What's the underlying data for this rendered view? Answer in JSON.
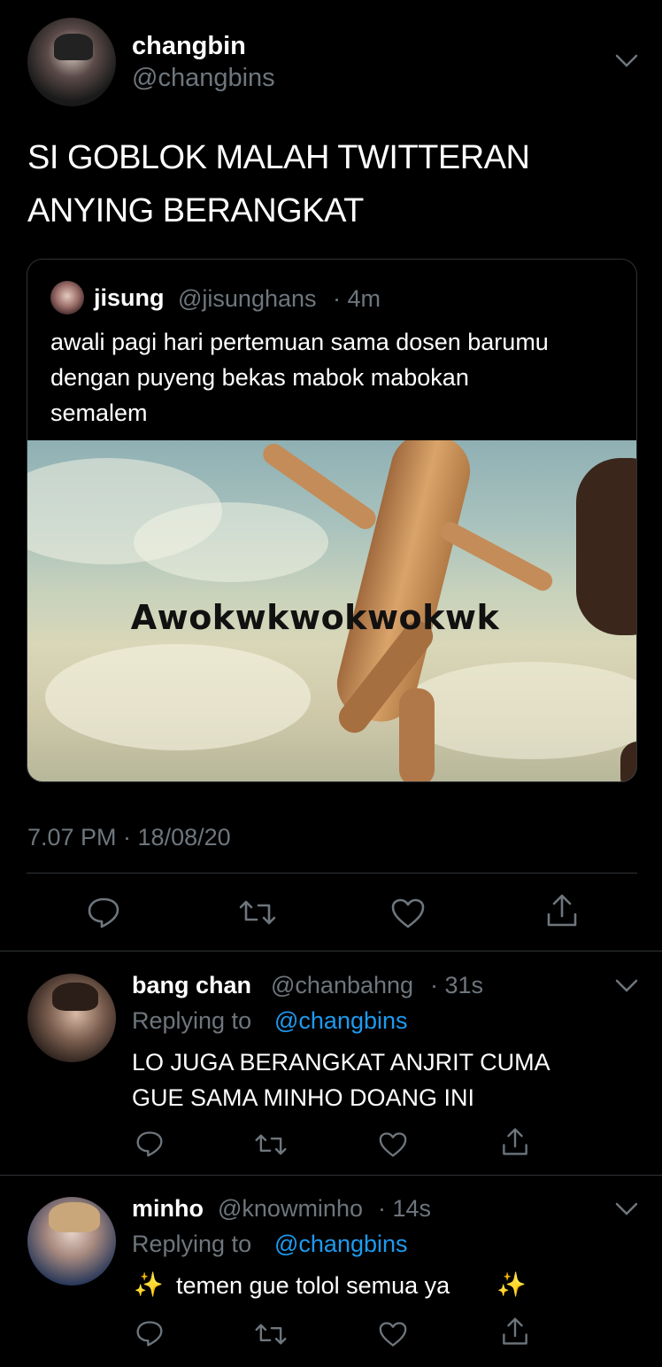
{
  "main_tweet": {
    "name": "changbin",
    "handle": "@changbins",
    "text_line1": "SI GOBLOK MALAH TWITTERAN",
    "text_line2": "ANYING BERANGKAT",
    "timestamp": "7.07 PM · 18/08/20",
    "quote": {
      "name": "jisung",
      "handle": "@jisunghans",
      "time": "· 4m",
      "text_line1": "awali pagi hari pertemuan sama dosen barumu",
      "text_line2": "dengan puyeng bekas mabok mabokan",
      "text_line3": "semalem",
      "image_caption": "Awokwkwokwokwk"
    }
  },
  "replies": [
    {
      "name": "bang chan",
      "handle": "@chanbahng",
      "time": "· 31s",
      "replying_prefix": "Replying to",
      "replying_to": "@changbins",
      "text_line1": "LO JUGA BERANGKAT ANJRIT CUMA",
      "text_line2": "GUE SAMA MINHO DOANG INI"
    },
    {
      "name": "minho",
      "handle": "@knowminho",
      "time": "· 14s",
      "replying_prefix": "Replying to",
      "replying_to": "@changbins",
      "sparkle": "✨",
      "text": "temen gue tolol semua ya"
    }
  ],
  "colors": {
    "background": "#000000",
    "muted": "#6e767d",
    "link": "#1d9bf0",
    "divider": "#2f3336"
  },
  "icons": [
    "chevron-down-icon",
    "reply-icon",
    "retweet-icon",
    "like-icon",
    "share-icon"
  ]
}
